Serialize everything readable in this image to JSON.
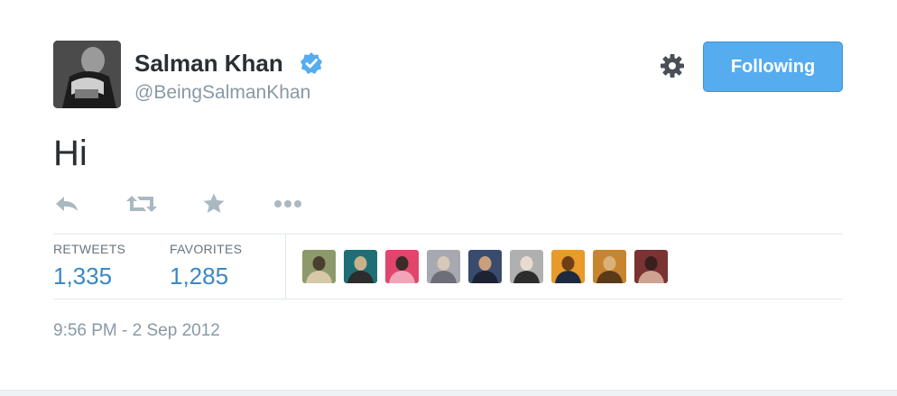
{
  "user": {
    "name": "Salman Khan",
    "handle": "@BeingSalmanKhan",
    "verified": true
  },
  "follow_button": {
    "label": "Following"
  },
  "tweet": {
    "text": "Hi"
  },
  "actions": {
    "reply_icon": "reply-icon",
    "retweet_icon": "retweet-icon",
    "favorite_icon": "star-icon",
    "more_icon": "more-icon"
  },
  "stats": {
    "retweets_label": "RETWEETS",
    "retweets_value": "1,335",
    "favorites_label": "FAVORITES",
    "favorites_value": "1,285"
  },
  "faces": [
    {
      "name": "face-1",
      "colors": [
        "#8c9a6b",
        "#d7c9a8",
        "#4a3f2f"
      ]
    },
    {
      "name": "face-2",
      "colors": [
        "#1e6f75",
        "#2c2c2c",
        "#c9b28a"
      ]
    },
    {
      "name": "face-3",
      "colors": [
        "#e2456b",
        "#f3a4b8",
        "#3a2a2a"
      ]
    },
    {
      "name": "face-4",
      "colors": [
        "#a8a8b0",
        "#6e6e78",
        "#d8c8b8"
      ]
    },
    {
      "name": "face-5",
      "colors": [
        "#3a4c6e",
        "#1d2333",
        "#c9a07a"
      ]
    },
    {
      "name": "face-6",
      "colors": [
        "#b0b0b0",
        "#2d2d2d",
        "#e8dcd0"
      ]
    },
    {
      "name": "face-7",
      "colors": [
        "#e89a2a",
        "#1f2a40",
        "#6d3f17"
      ]
    },
    {
      "name": "face-8",
      "colors": [
        "#c7852f",
        "#5b3a1a",
        "#d9b27a"
      ]
    },
    {
      "name": "face-9",
      "colors": [
        "#7a3232",
        "#cfa392",
        "#3a1f1f"
      ]
    }
  ],
  "timestamp": "9:56 PM - 2 Sep 2012",
  "colors": {
    "accent": "#55acee",
    "stat_value": "#3b88c3",
    "muted": "#8899a6",
    "text": "#292f33"
  }
}
